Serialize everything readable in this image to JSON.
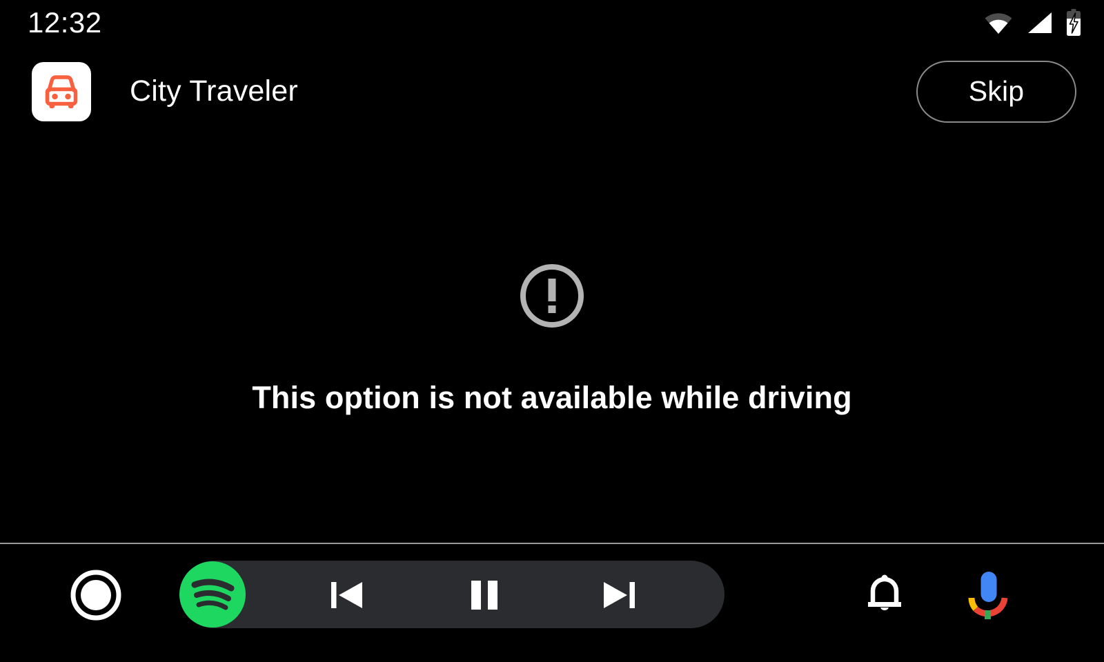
{
  "status_bar": {
    "clock": "12:32",
    "icons": [
      {
        "name": "wifi-icon",
        "label": "Wi-Fi signal partial"
      },
      {
        "name": "cellular-signal-icon",
        "label": "Cellular signal full"
      },
      {
        "name": "battery-charging-icon",
        "label": "Battery charging"
      }
    ]
  },
  "app_header": {
    "app_icon_name": "car-app-icon",
    "app_icon_color": "#f9603f",
    "app_icon_bg": "#ffffff",
    "app_title": "City Traveler",
    "skip_label": "Skip",
    "skip_border_color": "#8a8a8a"
  },
  "content": {
    "error_icon_name": "error-exclamation-circle-icon",
    "error_icon_color": "#b3b3b3",
    "message": "This option is not available while driving"
  },
  "nav_bar": {
    "divider_color": "#9a9a9a",
    "pill_bg": "#2a2c2f",
    "home_label": "Home",
    "media_app": {
      "name": "spotify-app-button",
      "label": "Spotify",
      "brand_color": "#1ed760"
    },
    "controls": [
      {
        "name": "previous-track-button",
        "label": "Previous"
      },
      {
        "name": "pause-button",
        "label": "Pause"
      },
      {
        "name": "next-track-button",
        "label": "Next"
      }
    ],
    "notifications_label": "Notifications",
    "assistant_label": "Google Assistant",
    "assistant_colors": {
      "blue": "#4285f4",
      "red": "#ea4335",
      "yellow": "#fbbc05",
      "green": "#34a853"
    }
  }
}
